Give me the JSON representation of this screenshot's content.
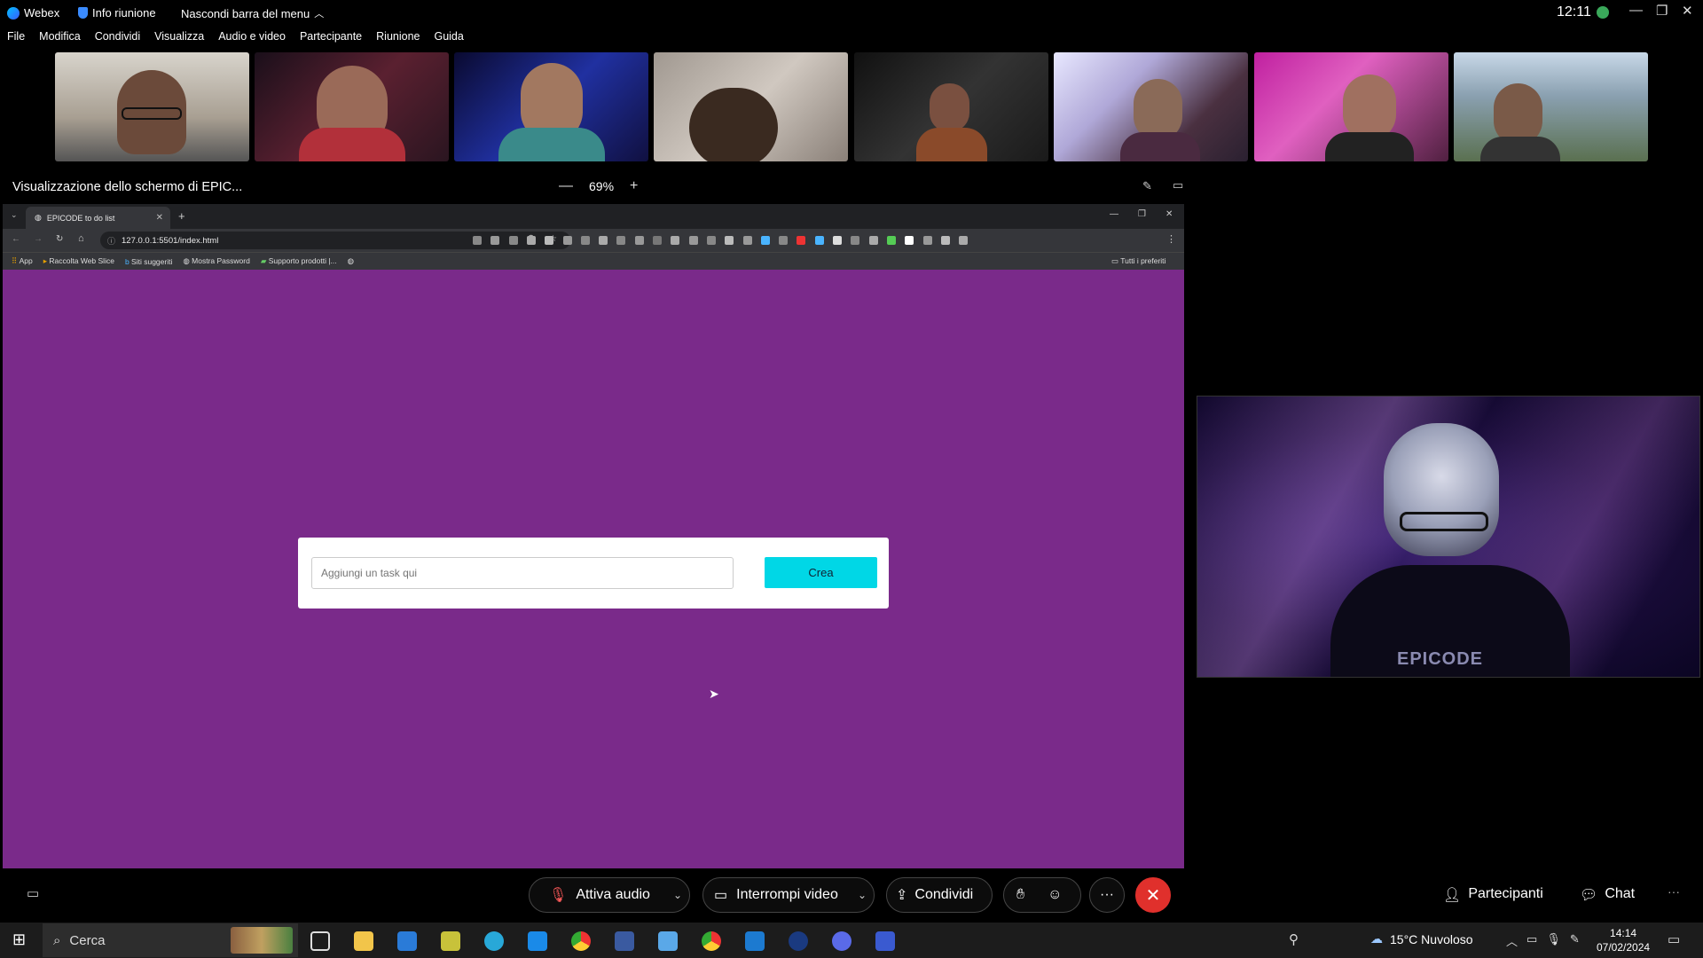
{
  "titlebar": {
    "app_name": "Webex",
    "meeting_info": "Info riunione",
    "hide_menu": "Nascondi barra del menu",
    "time": "12:11"
  },
  "menu": [
    "File",
    "Modifica",
    "Condividi",
    "Visualizza",
    "Audio e video",
    "Partecipante",
    "Riunione",
    "Guida"
  ],
  "share": {
    "title": "Visualizzazione dello schermo di EPIC...",
    "zoom": "69%"
  },
  "browser": {
    "tab_title": "EPICODE to do list",
    "url": "127.0.0.1:5501/index.html",
    "bookmarks": [
      "App",
      "Raccolta Web Slice",
      "Siti suggeriti",
      "Mostra Password",
      "Supporto prodotti |..."
    ],
    "all_favorites": "Tutti i preferiti"
  },
  "todo": {
    "placeholder": "Aggiungi un task qui",
    "button": "Crea"
  },
  "controls": {
    "audio": "Attiva audio",
    "video": "Interrompi video",
    "share": "Condividi",
    "participants": "Partecipanti",
    "chat": "Chat"
  },
  "taskbar": {
    "search": "Cerca",
    "weather": "15°C  Nuvoloso",
    "time": "14:14",
    "date": "07/02/2024"
  },
  "colors": {
    "page_bg": "#7a2a8a",
    "create_button": "#00d7e6",
    "end_call": "#e0302c"
  }
}
